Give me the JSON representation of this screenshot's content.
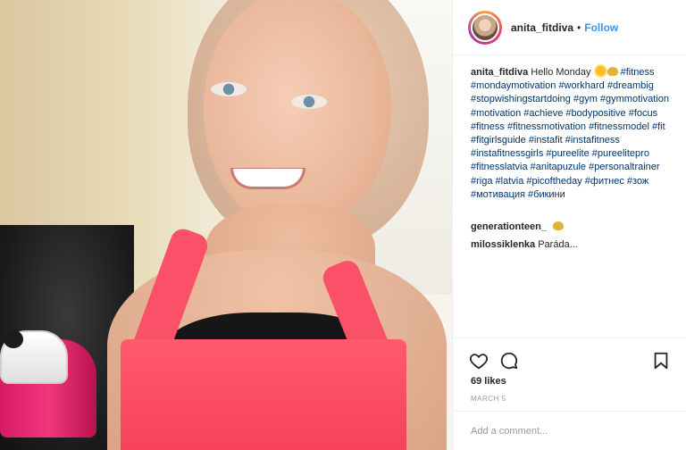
{
  "post": {
    "username": "anita_fitdiva",
    "separator": "•",
    "follow_label": "Follow",
    "caption_text": "Hello Monday",
    "hashtags": "#fitness #mondaymotivation #workhard #dreambig #stopwishingstartdoing #gym #gymmotivation #motivation #achieve #bodypositive #focus #fitness #fitnessmotivation #fitnessmodel #fit #fitgirlsguide #instafit #instafitness #instafitnessgirls #pureelite #pureelitepro #fitnesslatvia #anitapuzule #personaltrainer #riga #latvia #picoftheday #фитнес #зож #мотивация #бикини"
  },
  "comments": [
    {
      "user": "generationteen_",
      "text": ""
    },
    {
      "user": "milossiklenka",
      "text": "Paráda..."
    }
  ],
  "likes_label": "69 likes",
  "date_label": "MARCH 5",
  "comment_placeholder": "Add a comment...",
  "icons": [
    "heart-icon",
    "comment-icon",
    "bookmark-icon",
    "sun-emoji",
    "flexed-biceps-emoji"
  ],
  "colors": {
    "link": "#3897f0",
    "hashtag": "#003569",
    "meta": "#999999"
  }
}
